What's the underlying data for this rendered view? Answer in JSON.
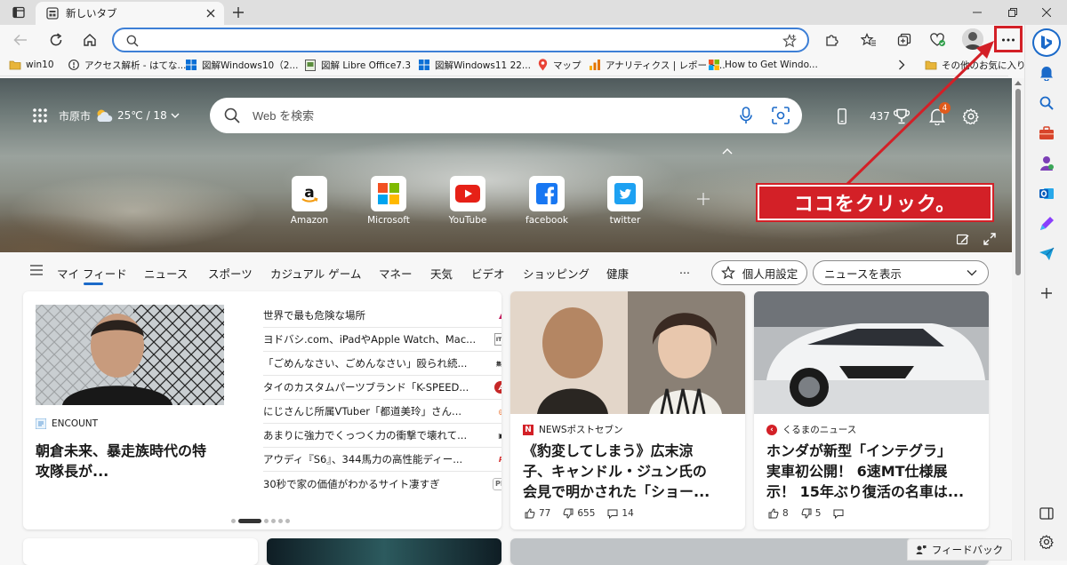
{
  "tab": {
    "title": "新しいタブ"
  },
  "address": {
    "value": "",
    "placeholder": ""
  },
  "bookmarks": [
    {
      "label": "win10",
      "icon": "folder-icon"
    },
    {
      "label": "アクセス解析 - はてな...",
      "icon": "hatena-icon"
    },
    {
      "label": "図解Windows10（2...",
      "icon": "windows-icon"
    },
    {
      "label": "図解 Libre Office7.3",
      "icon": "libreoffice-icon"
    },
    {
      "label": "図解Windows11 22...",
      "icon": "windows-icon"
    },
    {
      "label": "マップ",
      "icon": "map-pin-icon"
    },
    {
      "label": "アナリティクス | レポート...",
      "icon": "analytics-icon"
    },
    {
      "label": "How to Get Windo...",
      "icon": "microsoft-icon"
    }
  ],
  "other_favorites": "その他のお気に入り",
  "hero": {
    "city": "市原市",
    "temp": "25℃ / 18",
    "search_placeholder": "Web を検索",
    "rewards_points": "437",
    "notification_count": "4"
  },
  "quicklinks": [
    {
      "label": "Amazon"
    },
    {
      "label": "Microsoft"
    },
    {
      "label": "YouTube"
    },
    {
      "label": "facebook"
    },
    {
      "label": "twitter"
    }
  ],
  "callout": "ココをクリック。",
  "feed_nav": {
    "items": [
      "マイ フィード",
      "ニュース",
      "スポーツ",
      "カジュアル ゲーム",
      "マネー",
      "天気",
      "ビデオ",
      "ショッピング",
      "健康"
    ],
    "more": "...",
    "personalize": "個人用設定",
    "news_select": "ニュースを表示"
  },
  "card1": {
    "source": "ENCOUNT",
    "title_line1": "朝倉未来、暴走族時代の特",
    "title_line2": "攻隊長が...",
    "list": [
      {
        "text": "世界で最も危険な場所",
        "logo": "▲"
      },
      {
        "text": "ヨドバシ.com、iPadやApple Watch、Mac...",
        "logo": "ITM"
      },
      {
        "text": "「ごめんなさい、ごめんなさい」殴られ続...",
        "logo": "集英"
      },
      {
        "text": "タイのカスタムパーツブランド「K-SPEED...",
        "logo": "A"
      },
      {
        "text": "にじさんじ所属VTuber「都道美玲」さん...",
        "logo": "◎"
      },
      {
        "text": "あまりに強力でくっつく力の衝撃で壊れて...",
        "logo": "▣"
      },
      {
        "text": "アウディ『S6』、344馬力の高性能ディー...",
        "logo": "R"
      },
      {
        "text": "30秒で家の価値がわかるサイト凄すぎ",
        "logo": "PR"
      }
    ]
  },
  "card2": {
    "source": "NEWSポストセブン",
    "title_line1": "《豹変してしまう》広末涼",
    "title_line2": "子、キャンドル・ジュン氏の",
    "title_line3": "会見で明かされた「ショー...",
    "likes": "77",
    "dislikes": "655",
    "comments": "14"
  },
  "card3": {
    "source": "くるまのニュース",
    "title_line1": "ホンダが新型「インテグラ」",
    "title_line2": "実車初公開！ 6速MT仕様展",
    "title_line3": "示！ 15年ぶり復活の名車は...",
    "likes": "8",
    "dislikes": "5"
  },
  "feedback": "フィードバック",
  "colors": {
    "accent": "#3d7fd6",
    "callout_red": "#d32027"
  }
}
